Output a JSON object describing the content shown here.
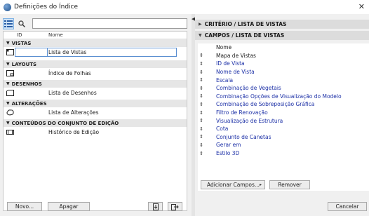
{
  "window": {
    "title": "Definições do Índice",
    "close_glyph": "✕"
  },
  "left": {
    "columns": {
      "id": "ID",
      "name": "Nome"
    },
    "sections": [
      {
        "title": "VISTAS",
        "rows": [
          {
            "icon": "view-icon",
            "name": "Lista de Vistas",
            "selected": true
          }
        ]
      },
      {
        "title": "LAYOUTS",
        "rows": [
          {
            "icon": "layout-icon",
            "name": "Índice de Folhas"
          }
        ]
      },
      {
        "title": "DESENHOS",
        "rows": [
          {
            "icon": "drawing-icon",
            "name": "Lista de Desenhos"
          }
        ]
      },
      {
        "title": "ALTERAÇÕES",
        "rows": [
          {
            "icon": "revision-icon",
            "name": "Lista de Alterações"
          }
        ]
      },
      {
        "title": "CONTEÚDOS DO CONJUNTO DE EDIÇÃO",
        "rows": [
          {
            "icon": "issue-set-icon",
            "name": "Histórico de Edição"
          }
        ]
      }
    ],
    "buttons": {
      "new": "Novo...",
      "delete": "Apagar"
    }
  },
  "right": {
    "criteria_header": "CRITÉRIO / LISTA DE VISTAS",
    "fields_header": "CAMPOS / LISTA DE VISTAS",
    "fields": [
      {
        "label": "Nome",
        "handle": false,
        "link": false
      },
      {
        "label": "Mapa de Vistas",
        "handle": true,
        "link": false
      },
      {
        "label": "ID de Vista",
        "handle": true,
        "link": true
      },
      {
        "label": "Nome de Vista",
        "handle": true,
        "link": true
      },
      {
        "label": "Escala",
        "handle": true,
        "link": true
      },
      {
        "label": "Combinação de Vegetais",
        "handle": true,
        "link": true
      },
      {
        "label": "Combinação Opções de Visualização do Modelo",
        "handle": true,
        "link": true
      },
      {
        "label": "Combinação de Sobreposição Gráfica",
        "handle": true,
        "link": true
      },
      {
        "label": "Filtro de Renovação",
        "handle": true,
        "link": true
      },
      {
        "label": "Visualização de Estrutura",
        "handle": true,
        "link": true
      },
      {
        "label": "Cota",
        "handle": true,
        "link": true
      },
      {
        "label": "Conjunto de Canetas",
        "handle": true,
        "link": true
      },
      {
        "label": "Gerar em",
        "handle": true,
        "link": true
      },
      {
        "label": "Estilo 3D",
        "handle": true,
        "link": true
      }
    ],
    "add_fields": "Adicionar Campos...",
    "add_fields_arrow": "▸",
    "remove": "Remover",
    "cancel": "Cancelar"
  },
  "colors": {
    "link_text": "#1b2fa6",
    "selection": "#5a8fd1"
  }
}
